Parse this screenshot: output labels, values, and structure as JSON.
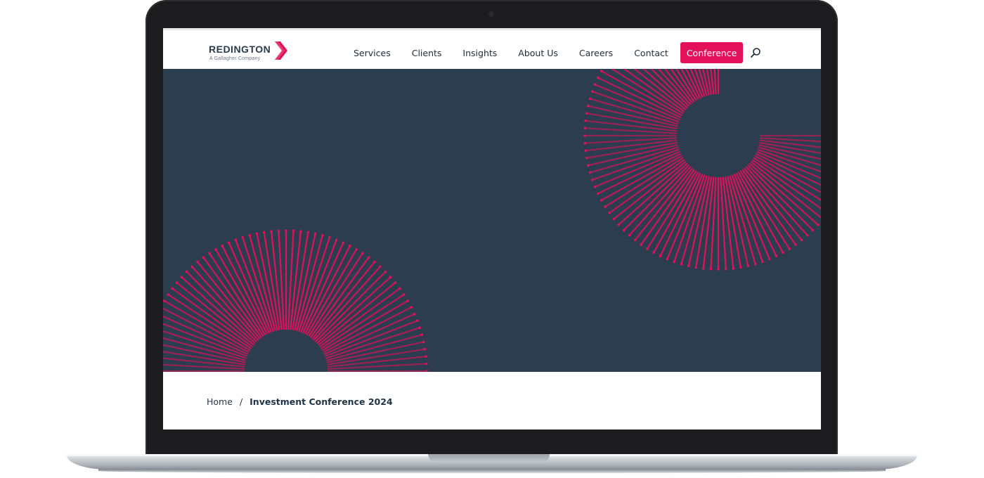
{
  "brand": {
    "name": "REDINGTON",
    "tagline": "A Gallagher Company",
    "accent": "#e3105a",
    "navy": "#2c3d4f"
  },
  "nav": {
    "items": [
      {
        "label": "Services"
      },
      {
        "label": "Clients"
      },
      {
        "label": "Insights"
      },
      {
        "label": "About Us"
      },
      {
        "label": "Careers"
      },
      {
        "label": "Contact"
      }
    ],
    "cta": "Conference",
    "search_icon": "search-icon"
  },
  "breadcrumb": {
    "home": "Home",
    "separator": "/",
    "current": "Investment Conference 2024"
  }
}
